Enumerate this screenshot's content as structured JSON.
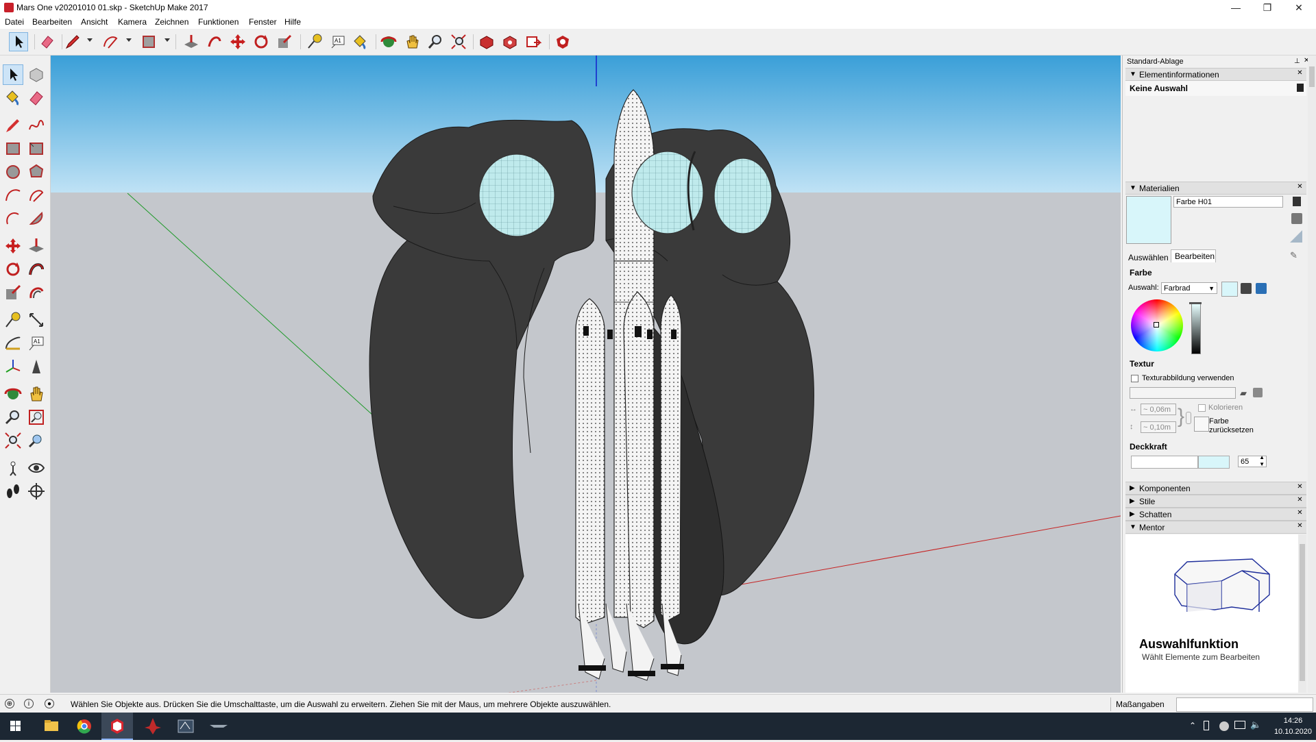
{
  "window": {
    "title": "Mars One v20201010 01.skp - SketchUp Make 2017",
    "controls": [
      "—",
      "❐",
      "✕"
    ]
  },
  "menu": [
    "Datei",
    "Bearbeiten",
    "Ansicht",
    "Kamera",
    "Zeichnen",
    "Funktionen",
    "Fenster",
    "Hilfe"
  ],
  "tray": {
    "title": "Standard-Ablage",
    "entity_info": {
      "header": "Elementinformationen",
      "selection": "Keine Auswahl"
    },
    "materials": {
      "header": "Materialien",
      "material_name": "Farbe H01",
      "swatch_color": "#d8f6fa",
      "tabs": [
        "Auswählen",
        "Bearbeiten"
      ],
      "color_section": "Farbe",
      "picker_label": "Auswahl:",
      "picker_value": "Farbrad",
      "texture_section": "Textur",
      "use_texture_label": "Texturabbildung verwenden",
      "width_value": "~ 0,06m",
      "height_value": "~ 0,10m",
      "colorize_label": "Kolorieren",
      "reset_color_label_1": "Farbe",
      "reset_color_label_2": "zurücksetzen",
      "opacity_section": "Deckkraft",
      "opacity_value": "65"
    },
    "collapsed_panels": [
      "Komponenten",
      "Stile",
      "Schatten"
    ],
    "mentor": {
      "header": "Mentor",
      "tool_title": "Auswahlfunktion",
      "tool_desc": "Wählt Elemente zum Bearbeiten"
    }
  },
  "status": {
    "message": "Wählen Sie Objekte aus. Drücken Sie die Umschalttaste, um die Auswahl zu erweitern. Ziehen Sie mit der Maus, um mehrere Objekte auszuwählen.",
    "measurements_label": "Maßangaben"
  },
  "taskbar": {
    "time": "14:26",
    "date": "10.10.2020"
  }
}
